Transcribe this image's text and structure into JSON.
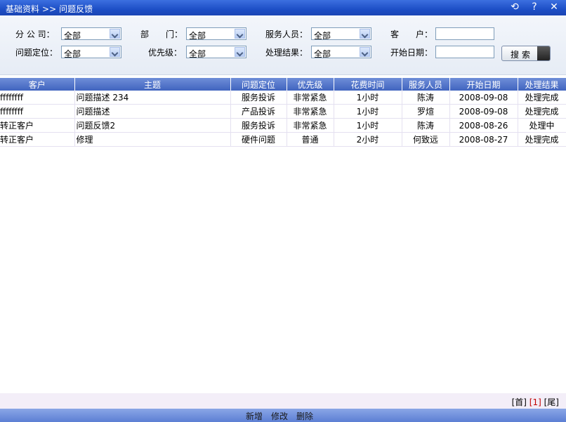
{
  "header": {
    "crumb": [
      "基础资料",
      ">>",
      "问题反馈"
    ],
    "icons": [
      "refresh-icon",
      "help-icon",
      "close-icon"
    ]
  },
  "filters": {
    "company_label": "分 公 司：",
    "company_value": "全部",
    "department_label": "部　　门：",
    "department_value": "全部",
    "service_label": "服务人员：",
    "service_value": "全部",
    "customer_label": "客　　户：",
    "customer_value": "",
    "position_label": "问题定位：",
    "position_value": "全部",
    "priority_label": "优先级：",
    "priority_value": "全部",
    "result_label": "处理结果：",
    "result_value": "全部",
    "start_date_label": "开始日期：",
    "start_date_value": "",
    "search_label": "搜索"
  },
  "table": {
    "columns": [
      "客户",
      "主题",
      "问题定位",
      "优先级",
      "花费时间",
      "服务人员",
      "开始日期",
      "处理结果"
    ],
    "rows": [
      [
        "ffffffff",
        "问题描述 234",
        "服务投诉",
        "非常紧急",
        "1小时",
        "陈涛",
        "2008-09-08",
        "处理完成"
      ],
      [
        "ffffffff",
        "问题描述",
        "产品投诉",
        "非常紧急",
        "1小时",
        "罗煊",
        "2008-09-08",
        "处理完成"
      ],
      [
        "转正客户",
        "问题反馈2",
        "服务投诉",
        "非常紧急",
        "1小时",
        "陈涛",
        "2008-08-26",
        "处理中"
      ],
      [
        "转正客户",
        "修理",
        "硬件问题",
        "普通",
        "2小时",
        "何致远",
        "2008-08-27",
        "处理完成"
      ]
    ]
  },
  "pager": {
    "first": "[首]",
    "current": "[1]",
    "last": "[尾]"
  },
  "actions": {
    "add": "新增",
    "edit": "修改",
    "delete": "删除"
  },
  "colors": {
    "title_bar": "#2452c8",
    "grid_header": "#5474c9",
    "pager_bg": "#f3eef8",
    "footer_bar": "#7393dd"
  }
}
